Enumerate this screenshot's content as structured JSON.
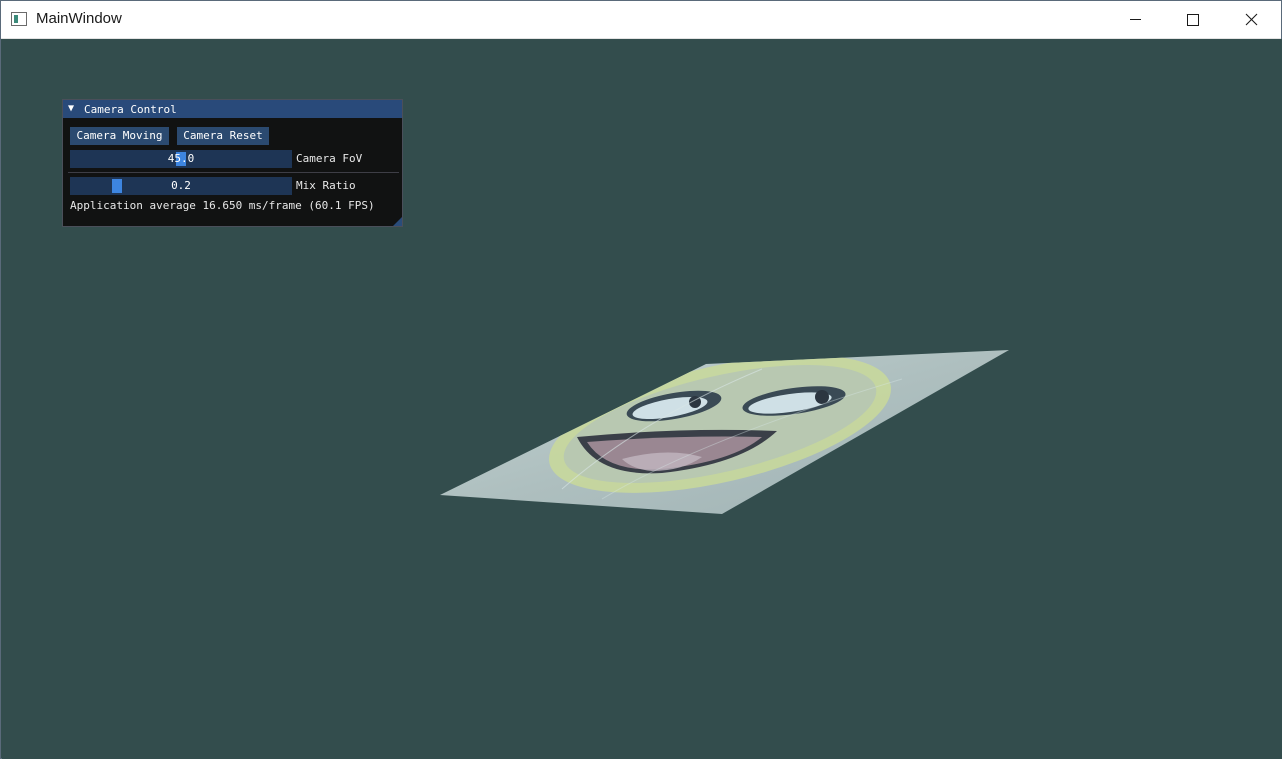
{
  "window": {
    "title": "MainWindow",
    "icons": {
      "app": "app-window-icon",
      "minimize": "minimize-icon",
      "maximize": "maximize-icon",
      "close": "close-icon"
    }
  },
  "scene": {
    "background": "#334d4d",
    "object": "textured-plane-smiley"
  },
  "panel": {
    "title": "Camera Control",
    "collapse_icon": "triangle-down-icon",
    "buttons": {
      "moving": "Camera Moving",
      "reset": "Camera Reset"
    },
    "fov": {
      "value": "45.0",
      "label": "Camera FoV",
      "level": 0.5
    },
    "mix": {
      "value": "0.2",
      "label": "Mix Ratio",
      "level": 0.2
    },
    "stats": "Application average 16.650 ms/frame (60.1 FPS)",
    "colors": {
      "title_bg": "#294a7a",
      "button_bg": "#2b4a70",
      "slider_bg": "#1e3555",
      "grab": "#3d85e0"
    }
  }
}
